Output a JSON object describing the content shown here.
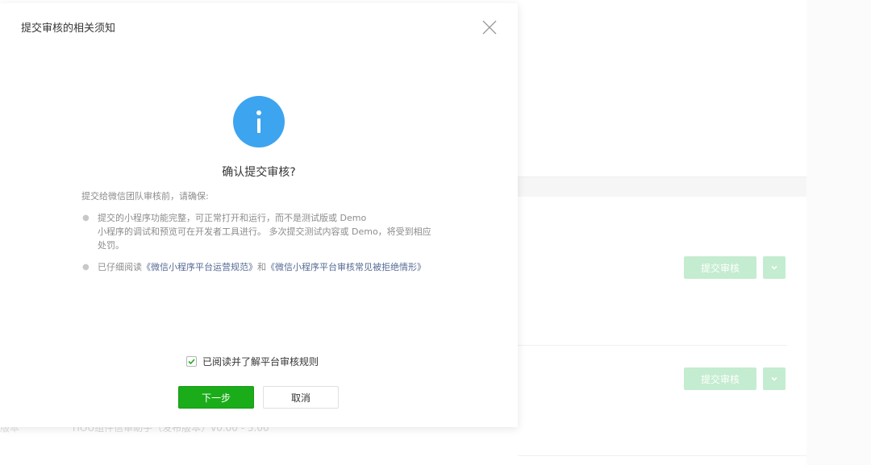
{
  "background": {
    "rows": [
      {
        "submit_label": "提交审核"
      },
      {
        "submit_label": "提交审核"
      }
    ],
    "footer_label": "版本",
    "footer_text": "TIOU组件信审助手（发布版本）v0.00 - 5.00"
  },
  "modal": {
    "title": "提交审核的相关须知",
    "confirm_title": "确认提交审核?",
    "intro": "提交给微信团队审核前，请确保:",
    "rule1_line1": "提交的小程序功能完整，可正常打开和运行，而不是测试版或 Demo",
    "rule1_line2": "小程序的调试和预览可在开发者工具进行。 多次提交测试内容或 Demo，将受到相应处罚。",
    "rule2_prefix": "已仔细阅读",
    "rule2_link1": "《微信小程序平台运营规范》",
    "rule2_and": "和",
    "rule2_link2": "《微信小程序平台审核常见被拒绝情形》",
    "agree_label": "已阅读并了解平台审核规则",
    "agree_checked": true,
    "next_label": "下一步",
    "cancel_label": "取消"
  },
  "colors": {
    "primary": "#1aad19",
    "info": "#3da4ef",
    "link": "#566b94",
    "disabled_green": "#c4ecd0"
  }
}
